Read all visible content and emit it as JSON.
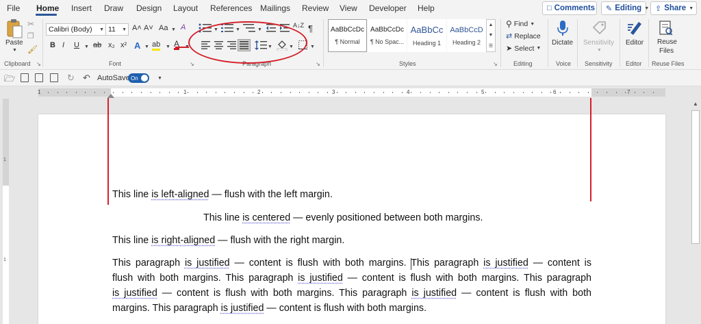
{
  "menu": {
    "tabs": [
      "File",
      "Home",
      "Insert",
      "Draw",
      "Design",
      "Layout",
      "References",
      "Mailings",
      "Review",
      "View",
      "Developer",
      "Help"
    ],
    "active": "Home",
    "comments_label": "Comments",
    "editing_label": "Editing",
    "share_label": "Share"
  },
  "ribbon": {
    "clipboard": {
      "paste_label": "Paste",
      "group_label": "Clipboard"
    },
    "font": {
      "font_name": "Calibri (Body)",
      "font_size": "11",
      "grow_label": "A˄",
      "shrink_label": "A˅",
      "case_label": "Aa",
      "clear_label": "A",
      "bold": "B",
      "italic": "I",
      "underline": "U",
      "strike": "ab",
      "subscript": "x₂",
      "superscript": "x²",
      "effects": "A",
      "highlight": "ab",
      "color": "A",
      "group_label": "Font"
    },
    "paragraph": {
      "sort_label": "A↓Z",
      "pilcrow": "¶",
      "group_label": "Paragraph"
    },
    "styles": {
      "items": [
        {
          "sample": "AaBbCcDc",
          "name": "¶ Normal"
        },
        {
          "sample": "AaBbCcDc",
          "name": "¶ No Spac..."
        },
        {
          "sample": "AaBbCc",
          "name": "Heading 1"
        },
        {
          "sample": "AaBbCcD",
          "name": "Heading 2"
        }
      ],
      "group_label": "Styles"
    },
    "editing": {
      "find": "Find",
      "replace": "Replace",
      "select": "Select",
      "group_label": "Editing"
    },
    "voice": {
      "dictate": "Dictate",
      "group_label": "Voice"
    },
    "sensitivity": {
      "button": "Sensitivity",
      "group_label": "Sensitivity"
    },
    "editor": {
      "button": "Editor",
      "group_label": "Editor"
    },
    "reuse": {
      "button_line1": "Reuse",
      "button_line2": "Files",
      "group_label": "Reuse Files"
    }
  },
  "qat": {
    "autosave_label": "AutoSave",
    "autosave_state": "On"
  },
  "ruler": {
    "numbers": [
      "1",
      "1",
      "2",
      "3",
      "4",
      "5",
      "6",
      "7"
    ]
  },
  "vruler": {
    "numbers": [
      "1",
      "1"
    ]
  },
  "document": {
    "left_line": [
      "This line ",
      "is left-aligned",
      " — flush with the left margin."
    ],
    "center_line": [
      "This line ",
      "is centered",
      " — evenly positioned between both margins."
    ],
    "right_line": [
      "This line ",
      "is right-aligned",
      " — flush with the right margin."
    ],
    "justified_lines": [
      [
        "This paragraph ",
        "is justified",
        " — content is flush with both margins. This paragraph ",
        "is justified",
        " — content is"
      ],
      [
        "flush with both margins. This paragraph ",
        "is justified",
        " — content is flush with both margins. This paragraph"
      ],
      [
        "",
        "is justified",
        " — content is flush with both margins. This paragraph ",
        "is justified",
        " — content is flush with both"
      ],
      [
        "margins. This paragraph ",
        "is justified",
        " — content is flush with both margins.",
        "",
        ""
      ]
    ]
  },
  "colors": {
    "accent": "#2b579a",
    "annotation": "#d41f2a",
    "autosave": "#1f5fae"
  }
}
